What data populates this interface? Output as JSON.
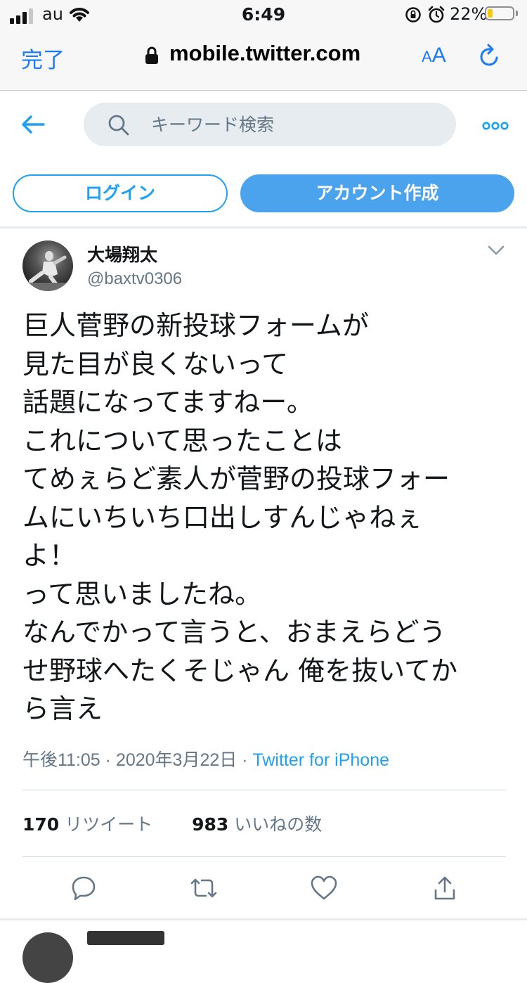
{
  "status_bar": {
    "carrier": "au",
    "time": "6:49",
    "battery_percent_label": "22%",
    "battery_level": 0.22,
    "battery_color": "#f7c90a",
    "icons": [
      "signal-icon",
      "wifi-icon",
      "rotation-lock-icon",
      "alarm-icon",
      "battery-icon"
    ]
  },
  "browser": {
    "done_label": "完了",
    "url": "mobile.twitter.com",
    "text_size_small": "A",
    "text_size_big": "A",
    "accent_color": "#1b7af5"
  },
  "header": {
    "search_placeholder": "キーワード検索"
  },
  "auth": {
    "login_label": "ログイン",
    "signup_label": "アカウント作成"
  },
  "tweet": {
    "display_name": "大場翔太",
    "handle": "@baxtv0306",
    "text_lines": [
      "巨人菅野の新投球フォームが",
      "見た目が良くないって",
      "話題になってますねー。",
      "これについて思ったことは",
      "てめぇらど素人が菅野の投球フォー",
      "ムにいちいち口出しすんじゃねぇ",
      "よ！",
      "って思いましたね。",
      "なんでかって言うと、おまえらどう",
      "せ野球へたくそじゃん 俺を抜いてか",
      "ら言え"
    ],
    "time": "午後11:05",
    "separator": " · ",
    "date": "2020年3月22日",
    "source": "Twitter for iPhone",
    "retweet_count": "170",
    "retweet_label": "リツイート",
    "like_count": "983",
    "like_label": "いいねの数"
  },
  "colors": {
    "twitter_blue": "#1da1f2",
    "secondary_text": "#657786"
  }
}
